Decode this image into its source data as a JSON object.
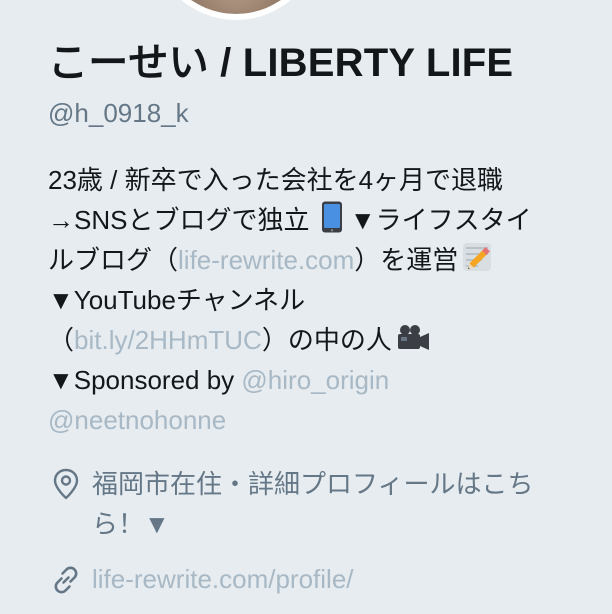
{
  "profile": {
    "name": "こーせい / LIBERTY LIFE",
    "handle": "@h_0918_k",
    "bio": {
      "l1": "23歳 / 新卒で入った会社を4ヶ月で退職",
      "l2": "→SNSとブログで独立",
      "l2b": " ▼ライフスタイ",
      "l3a": "ルブログ（",
      "l3link": "life-rewrite.com",
      "l3b": "）を運営",
      "l4": "▼YouTubeチャンネル",
      "l5a": "（",
      "l5link": "bit.ly/2HHmTUC",
      "l5b": "）の中の人",
      "l6a": "▼Sponsored by ",
      "l6mention": "@hiro_origin",
      "l7mention": "@neetnohonne"
    },
    "location": "福岡市在住・詳細プロフィールはこちら！▼",
    "website": "life-rewrite.com/profile/"
  },
  "icons": {
    "location": "map-pin-icon",
    "website": "link-icon",
    "phone_emoji": "mobile-phone-emoji",
    "memo_emoji": "memo-emoji",
    "camera_emoji": "video-camera-emoji"
  },
  "colors": {
    "background": "#e6ecf0",
    "text": "#14171a",
    "secondary": "#657786",
    "link": "#a8b8c4"
  }
}
